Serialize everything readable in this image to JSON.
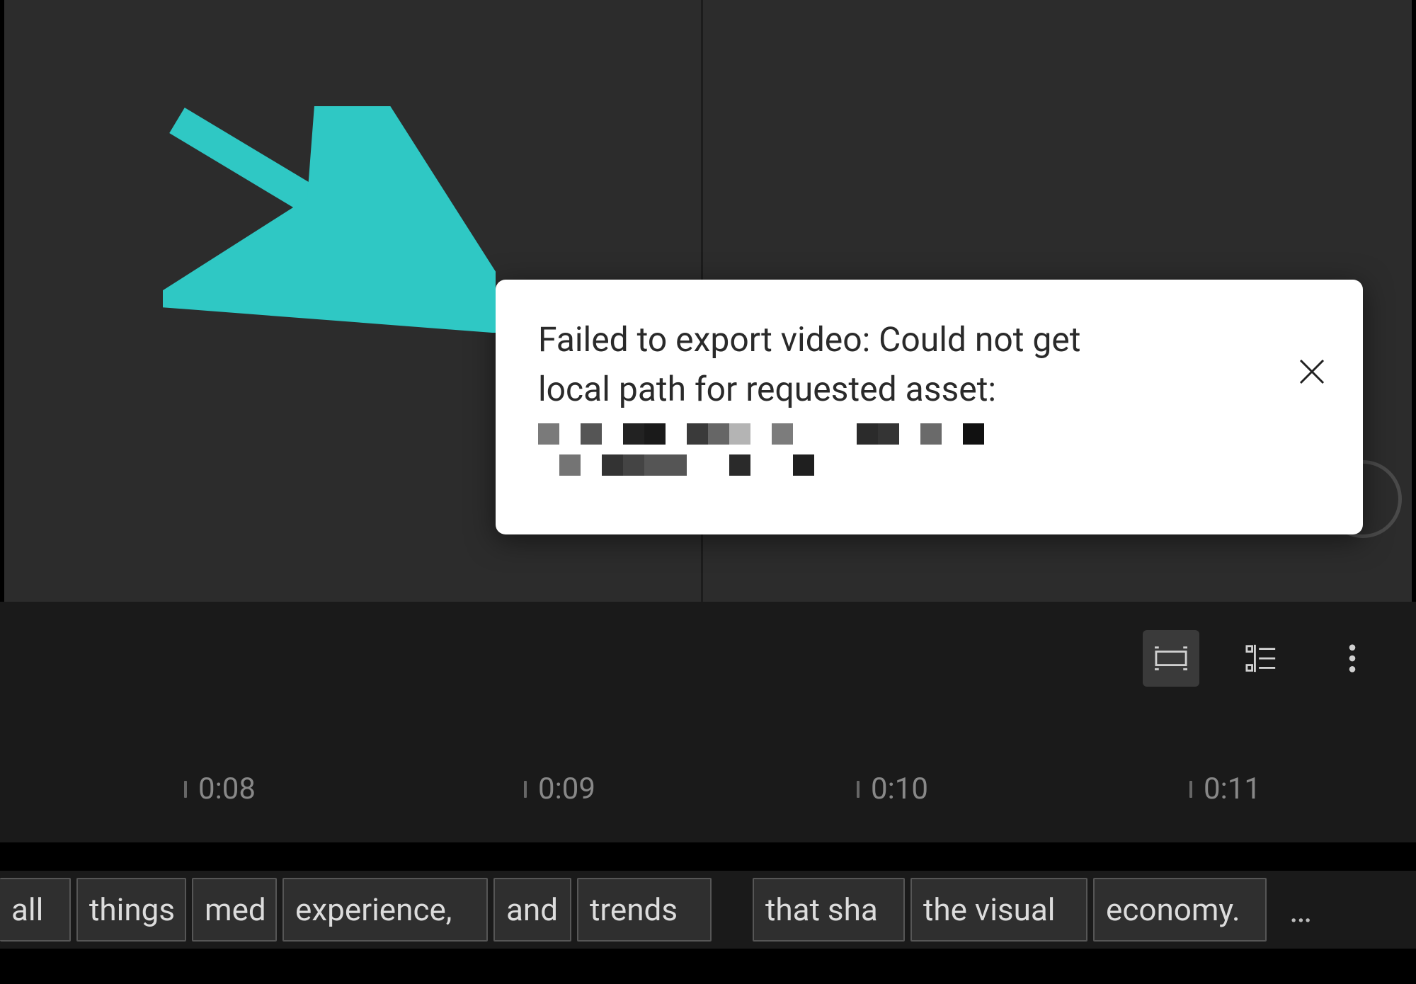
{
  "toast": {
    "message_line1": "Failed to export video: Could not get",
    "message_line2": "local path for requested asset:",
    "close_label": "Close"
  },
  "timeline": {
    "ticks": [
      "0:08",
      "0:09",
      "0:10",
      "0:11"
    ]
  },
  "captions": {
    "segments": [
      "all",
      "things",
      "med",
      "experience,",
      "and",
      "trends",
      "that sha",
      "the visual",
      "economy."
    ],
    "ellipsis": "…"
  },
  "toolbar": {
    "view_mode_a": "timeline-view",
    "view_mode_b": "list-view",
    "more": "more-options"
  },
  "colors": {
    "arrow": "#2fc8c4",
    "bg_dark": "#1a1a1a",
    "bg_preview": "#2c2c2c"
  }
}
